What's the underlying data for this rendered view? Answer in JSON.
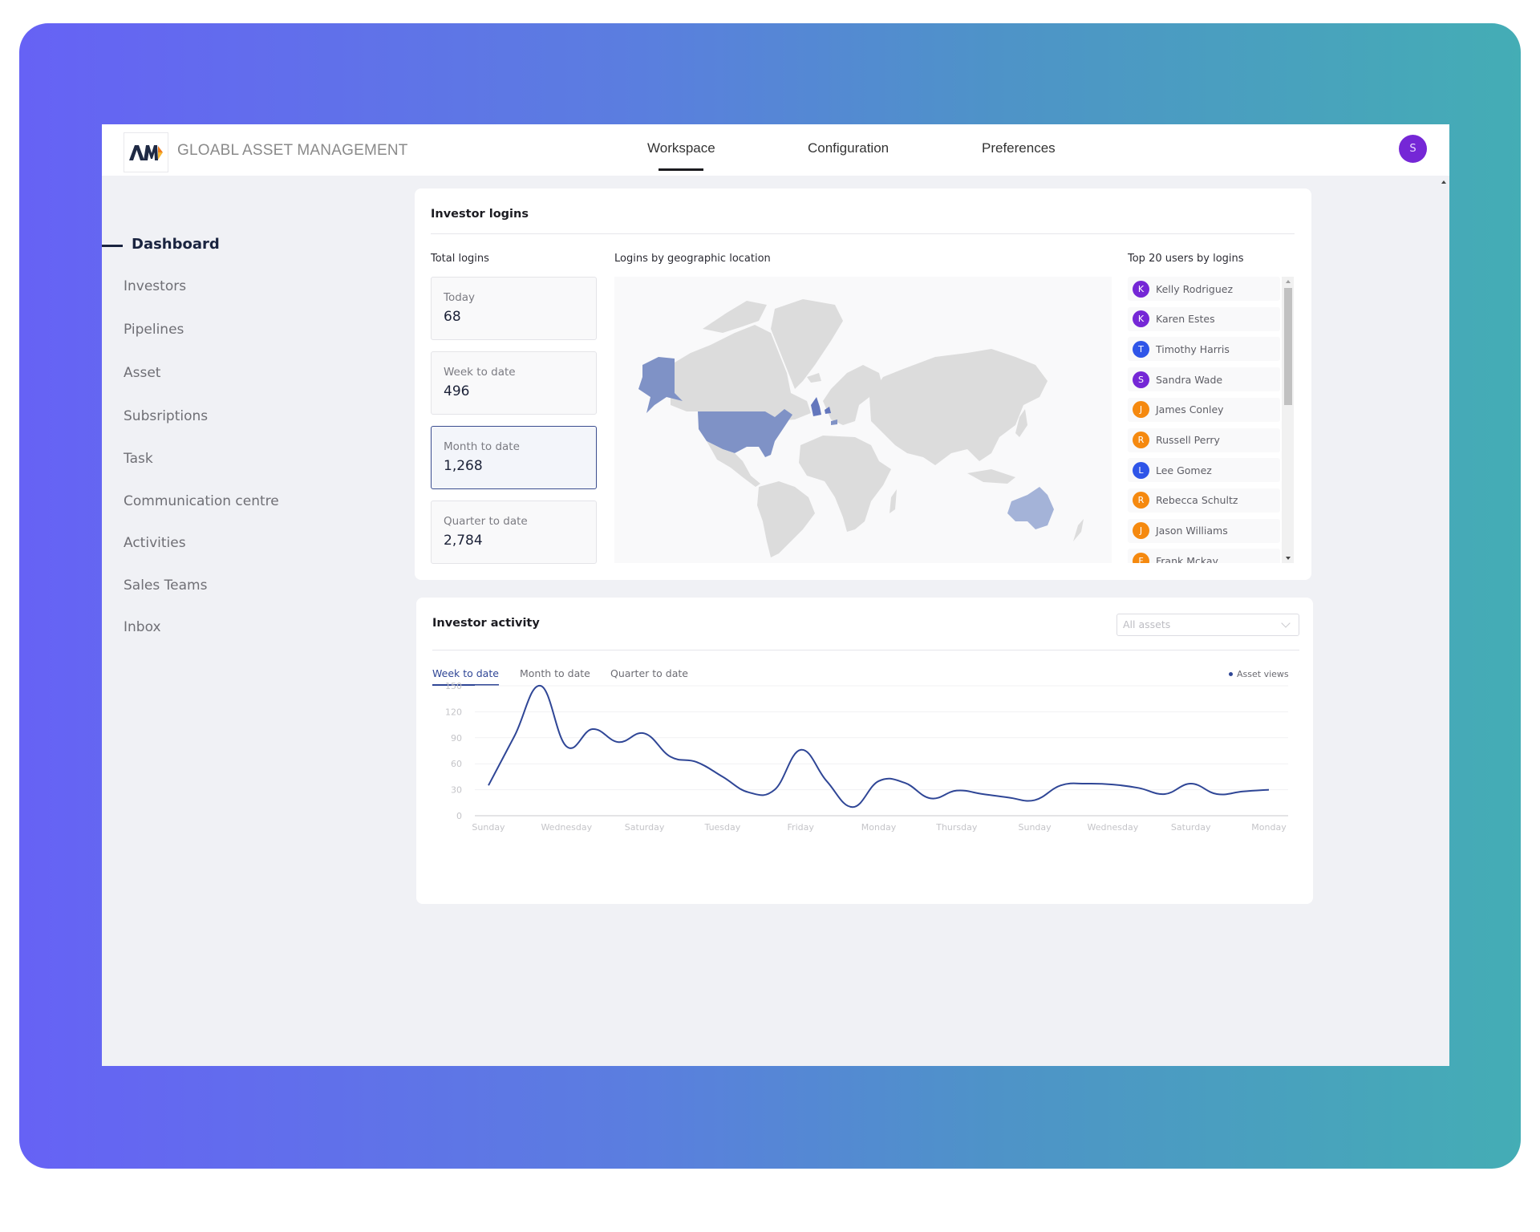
{
  "header": {
    "brand": "GLOABL ASSET MANAGEMENT",
    "logo_text": "AM",
    "nav": [
      {
        "label": "Workspace",
        "active": true
      },
      {
        "label": "Configuration",
        "active": false
      },
      {
        "label": "Preferences",
        "active": false
      }
    ],
    "avatar_initial": "S",
    "avatar_color": "#7527d6"
  },
  "sidebar": {
    "items": [
      {
        "label": "Dashboard",
        "active": true
      },
      {
        "label": "Investors"
      },
      {
        "label": "Pipelines"
      },
      {
        "label": "Asset"
      },
      {
        "label": "Subsriptions"
      },
      {
        "label": "Task"
      },
      {
        "label": "Communication centre"
      },
      {
        "label": "Activities"
      },
      {
        "label": "Sales Teams"
      },
      {
        "label": "Inbox"
      }
    ]
  },
  "logins": {
    "title": "Investor logins",
    "total_title": "Total logins",
    "stats": [
      {
        "label": "Today",
        "value": "68"
      },
      {
        "label": "Week to date",
        "value": "496"
      },
      {
        "label": "Month to date",
        "value": "1,268",
        "selected": true
      },
      {
        "label": "Quarter to date",
        "value": "2,784"
      }
    ],
    "map_title": "Logins by geographic location",
    "map_highlighted": [
      {
        "region": "United States",
        "color": "#8092c6"
      },
      {
        "region": "United Kingdom",
        "color": "#6477bd"
      },
      {
        "region": "Netherlands",
        "color": "#6477bd"
      },
      {
        "region": "Switzerland",
        "color": "#8092c6"
      },
      {
        "region": "Australia",
        "color": "#a4b3d8"
      }
    ],
    "top_users_title": "Top 20 users by logins",
    "top_users": [
      {
        "initial": "K",
        "name": "Kelly Rodriguez",
        "color": "#7527d6"
      },
      {
        "initial": "K",
        "name": "Karen Estes",
        "color": "#7527d6"
      },
      {
        "initial": "T",
        "name": "Timothy Harris",
        "color": "#2f55e8"
      },
      {
        "initial": "S",
        "name": "Sandra Wade",
        "color": "#7527d6"
      },
      {
        "initial": "J",
        "name": "James Conley",
        "color": "#f5890f"
      },
      {
        "initial": "R",
        "name": "Russell Perry",
        "color": "#f5890f"
      },
      {
        "initial": "L",
        "name": "Lee Gomez",
        "color": "#2f55e8"
      },
      {
        "initial": "R",
        "name": "Rebecca Schultz",
        "color": "#f5890f"
      },
      {
        "initial": "J",
        "name": "Jason Williams",
        "color": "#f5890f"
      },
      {
        "initial": "F",
        "name": "Frank Mckay",
        "color": "#f5890f"
      }
    ]
  },
  "activity": {
    "title": "Investor activity",
    "select_placeholder": "All assets",
    "tabs": [
      {
        "label": "Week to date",
        "active": true
      },
      {
        "label": "Month to date"
      },
      {
        "label": "Quarter to date"
      }
    ],
    "legend_label": "Asset views"
  },
  "chart_data": {
    "type": "line",
    "title": "Investor activity",
    "xlabel": "",
    "ylabel": "",
    "ylim": [
      0,
      150
    ],
    "yticks": [
      0,
      30,
      60,
      90,
      120,
      150
    ],
    "grid": true,
    "legend_position": "top-right",
    "x_tick_labels": [
      "Sunday",
      "Wednesday",
      "Saturday",
      "Tuesday",
      "Friday",
      "Monday",
      "Thursday",
      "Sunday",
      "Wednesday",
      "Saturday",
      "Monday"
    ],
    "series": [
      {
        "name": "Asset views",
        "color": "#2f4696",
        "values": [
          35,
          92,
          150,
          80,
          100,
          85,
          95,
          68,
          62,
          45,
          27,
          30,
          76,
          40,
          10,
          40,
          38,
          20,
          29,
          25,
          21,
          18,
          35,
          37,
          36,
          32,
          25,
          37,
          25,
          28,
          30
        ]
      }
    ]
  }
}
